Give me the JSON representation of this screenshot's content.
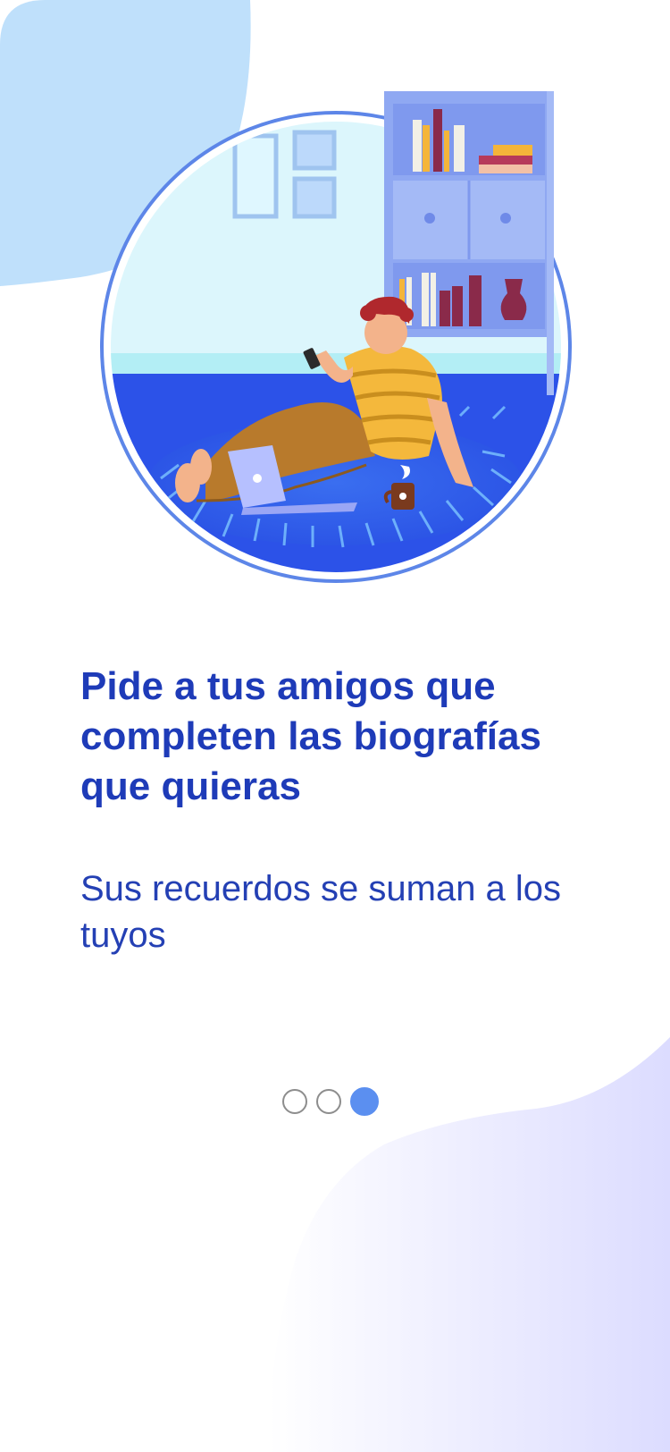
{
  "colors": {
    "title": "#1e3bb8",
    "subtitle": "#2440b4",
    "dot_active": "#5b8ff0",
    "dot_inactive_border": "#8d8d8d",
    "blob_top": "#bfe0fb",
    "blob_bottom": "#dcdcff"
  },
  "onboarding": {
    "title": "Pide a tus amigos que completen las biografías que quieras",
    "subtitle": "Sus recuerdos se suman a los tuyos"
  },
  "pager": {
    "total": 3,
    "active_index": 3
  },
  "illustration": {
    "icon": "person-on-floor-with-phone-illustration"
  }
}
